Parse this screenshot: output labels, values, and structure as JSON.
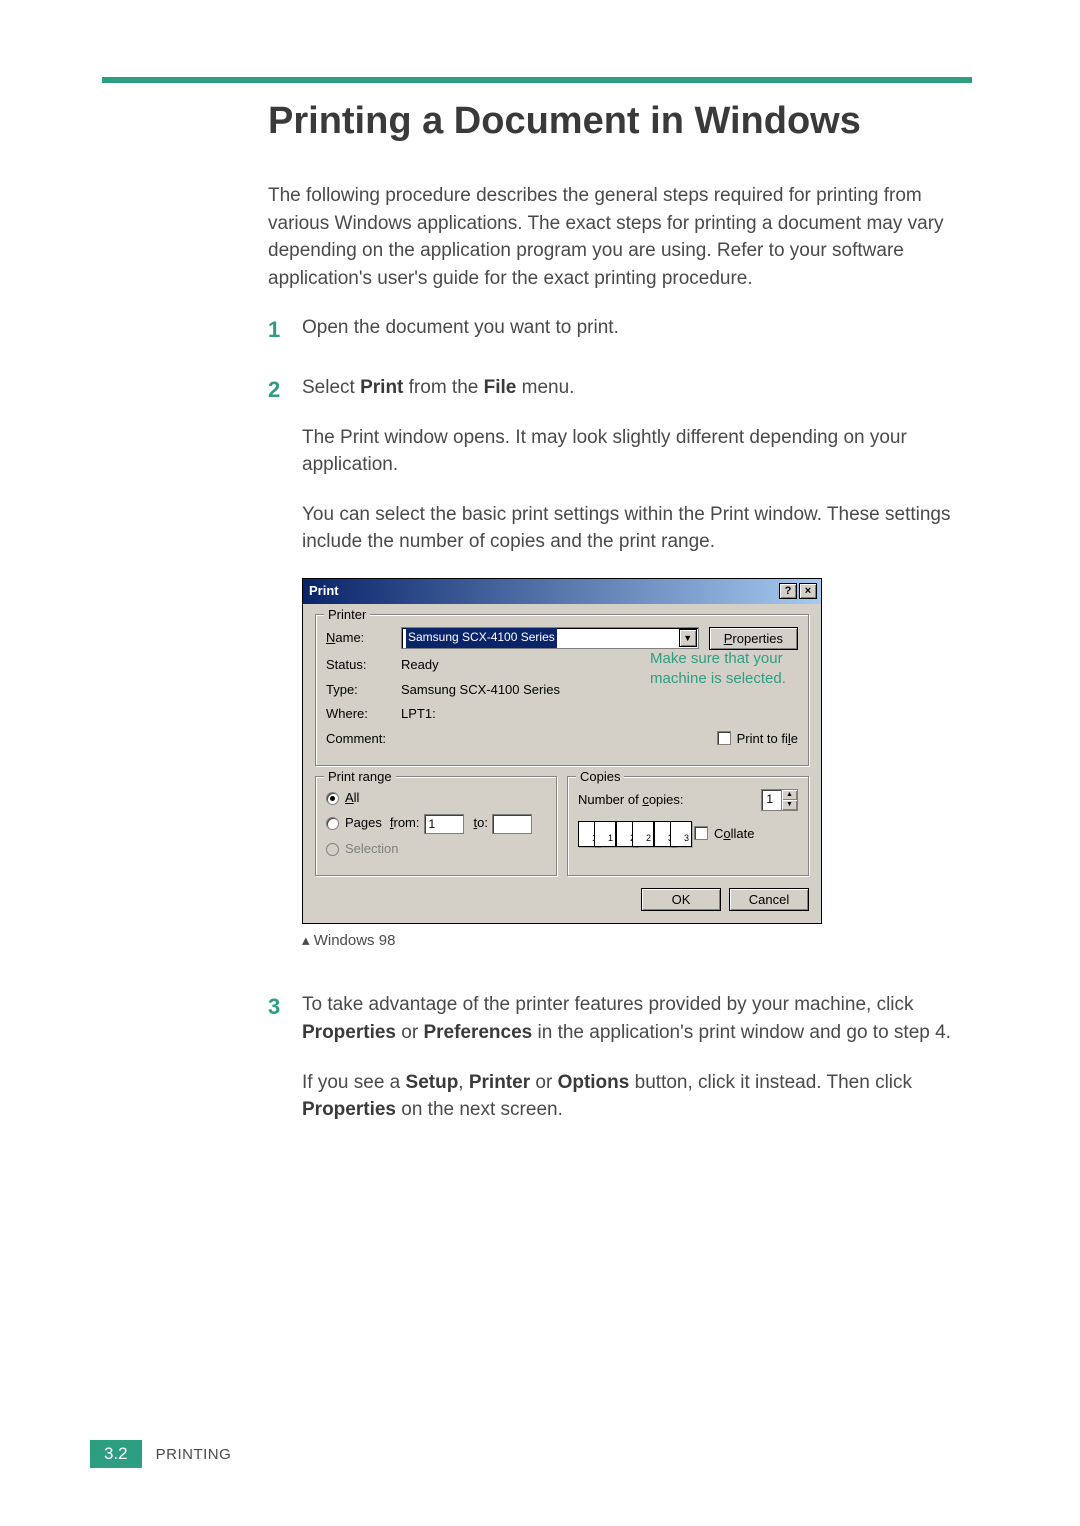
{
  "heading": "Printing a Document in Windows",
  "intro": "The following procedure describes the general steps required for printing from various Windows applications. The exact steps for printing a document may vary depending on the application program you are using. Refer to your software application's user's guide for the exact printing procedure.",
  "step1": {
    "num": "1",
    "text": "Open the document you want to print."
  },
  "step2": {
    "num": "2",
    "line1_pre": "Select ",
    "line1_b1": "Print",
    "line1_mid": " from the ",
    "line1_b2": "File",
    "line1_post": " menu.",
    "para2": "The Print window opens. It may look slightly different depending on your application.",
    "para3": "You can select the basic print settings within the Print window. These settings include the number of copies and the print range."
  },
  "dialog": {
    "title": "Print",
    "help_icon": "?",
    "close_icon": "×",
    "printer_legend": "Printer",
    "name_label": "Name:",
    "name_value": "Samsung SCX-4100 Series",
    "properties_btn": "Properties",
    "status_label": "Status:",
    "status_value": "Ready",
    "type_label": "Type:",
    "type_value": "Samsung SCX-4100 Series",
    "where_label": "Where:",
    "where_value": "LPT1:",
    "comment_label": "Comment:",
    "print_to_file": "Print to file",
    "print_range_legend": "Print range",
    "all_label": "All",
    "pages_label": "Pages",
    "from_label": "from:",
    "from_value": "1",
    "to_label": "to:",
    "to_value": "",
    "selection_label": "Selection",
    "copies_legend": "Copies",
    "num_copies_label": "Number of copies:",
    "num_copies_value": "1",
    "collate_label": "Collate",
    "ok_btn": "OK",
    "cancel_btn": "Cancel",
    "callout": "Make sure that your machine is selected."
  },
  "caption": "Windows 98",
  "step3": {
    "num": "3",
    "p1_pre": "To take advantage of the printer features provided by your machine, click ",
    "p1_b1": "Properties",
    "p1_mid": " or ",
    "p1_b2": "Preferences",
    "p1_post": " in the application's print window and go to step 4.",
    "p2_pre": "If you see a ",
    "p2_b1": "Setup",
    "p2_c1": ", ",
    "p2_b2": "Printer",
    "p2_mid": " or ",
    "p2_b3": "Options",
    "p2_mid2": " button, click it instead. Then click ",
    "p2_b4": "Properties",
    "p2_post": " on the next screen."
  },
  "footer": {
    "page": "3.2",
    "section": "PRINTING"
  }
}
